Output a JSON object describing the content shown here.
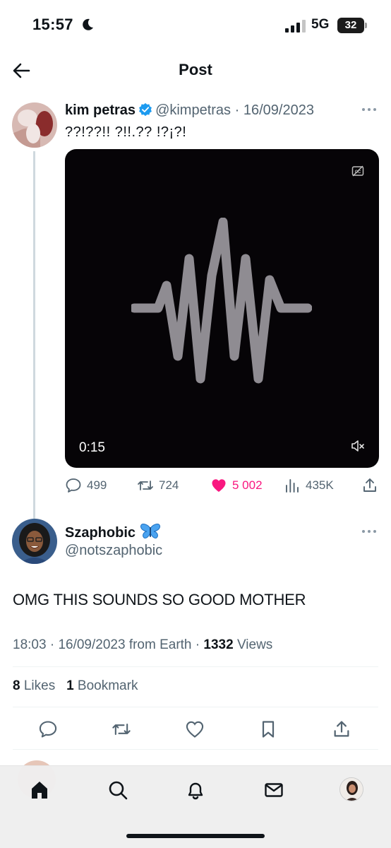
{
  "status_bar": {
    "time": "15:57",
    "network": "5G",
    "battery": "32"
  },
  "header": {
    "title": "Post"
  },
  "original_post": {
    "author_name": "kim petras",
    "handle": "@kimpetras",
    "date": "16/09/2023",
    "text": "??!??!!  ?!!.?? !?¡?!",
    "media": {
      "duration": "0:15"
    },
    "replies": "499",
    "reposts": "724",
    "likes": "5 002",
    "views": "435K"
  },
  "reply_post": {
    "author_name": "Szaphobic",
    "handle": "@notszaphobic",
    "text": "OMG THIS SOUNDS SO GOOD MOTHER",
    "time": "18:03",
    "date": "16/09/2023",
    "source": "from Earth",
    "views_count": "1332",
    "views_label": "Views",
    "likes_count": "8",
    "likes_label": "Likes",
    "bookmarks_count": "1",
    "bookmarks_label": "Bookmark"
  },
  "colors": {
    "accent": "#1d9bf0",
    "like": "#f91880",
    "muted_text": "#536471",
    "media_bg": "#060407",
    "waveform": "#8f8c92"
  },
  "tab_bar": {
    "items": [
      "home-icon",
      "search-icon",
      "notifications-icon",
      "messages-icon",
      "profile-avatar"
    ]
  }
}
